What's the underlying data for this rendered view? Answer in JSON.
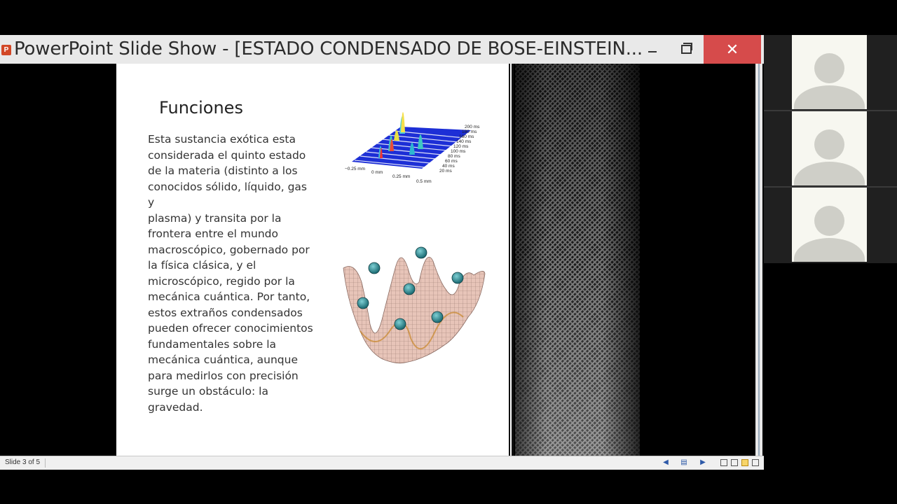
{
  "window": {
    "title": "PowerPoint Slide Show - [ESTADO CONDENSADO DE BOSE-EINSTEIN...",
    "app_icon_letter": "P",
    "close_glyph": "✕"
  },
  "slide": {
    "heading": "Funciones",
    "body": "Esta sustancia exótica esta\nconsiderada el quinto estado\nde la materia (distinto a los\nconocidos sólido, líquido, gas y\nplasma) y transita por la\nfrontera entre el mundo\nmacroscópico, gobernado por\nla física clásica, y el\nmicroscópico, regido por la\nmecánica cuántica. Por tanto,\nestos extraños condensados\npueden ofrecer conocimientos\nfundamentales sobre la\nmecánica cuántica, aunque\npara medirlos con precisión\nsurge un obstáculo: la\ngravedad.",
    "figure1": {
      "time_labels": [
        "200 ms",
        "180 ms",
        "160 ms",
        "140 ms",
        "120 ms",
        "100 ms",
        "80 ms",
        "60 ms",
        "40 ms",
        "20 ms"
      ],
      "axis_labels": [
        "−0.25 mm",
        "0 mm",
        "0.25 mm",
        "0.5 mm"
      ]
    }
  },
  "statusbar": {
    "slide_count": "Slide 3 of 5"
  },
  "colors": {
    "close_button": "#d64b4b",
    "titlebar": "#e9e9e9",
    "avatar_bg": "#f7f7f0",
    "avatar_fg": "#cfcfc8"
  },
  "participants": [
    {
      "icon": "user-silhouette-icon"
    },
    {
      "icon": "user-silhouette-icon"
    },
    {
      "icon": "user-silhouette-icon"
    }
  ]
}
